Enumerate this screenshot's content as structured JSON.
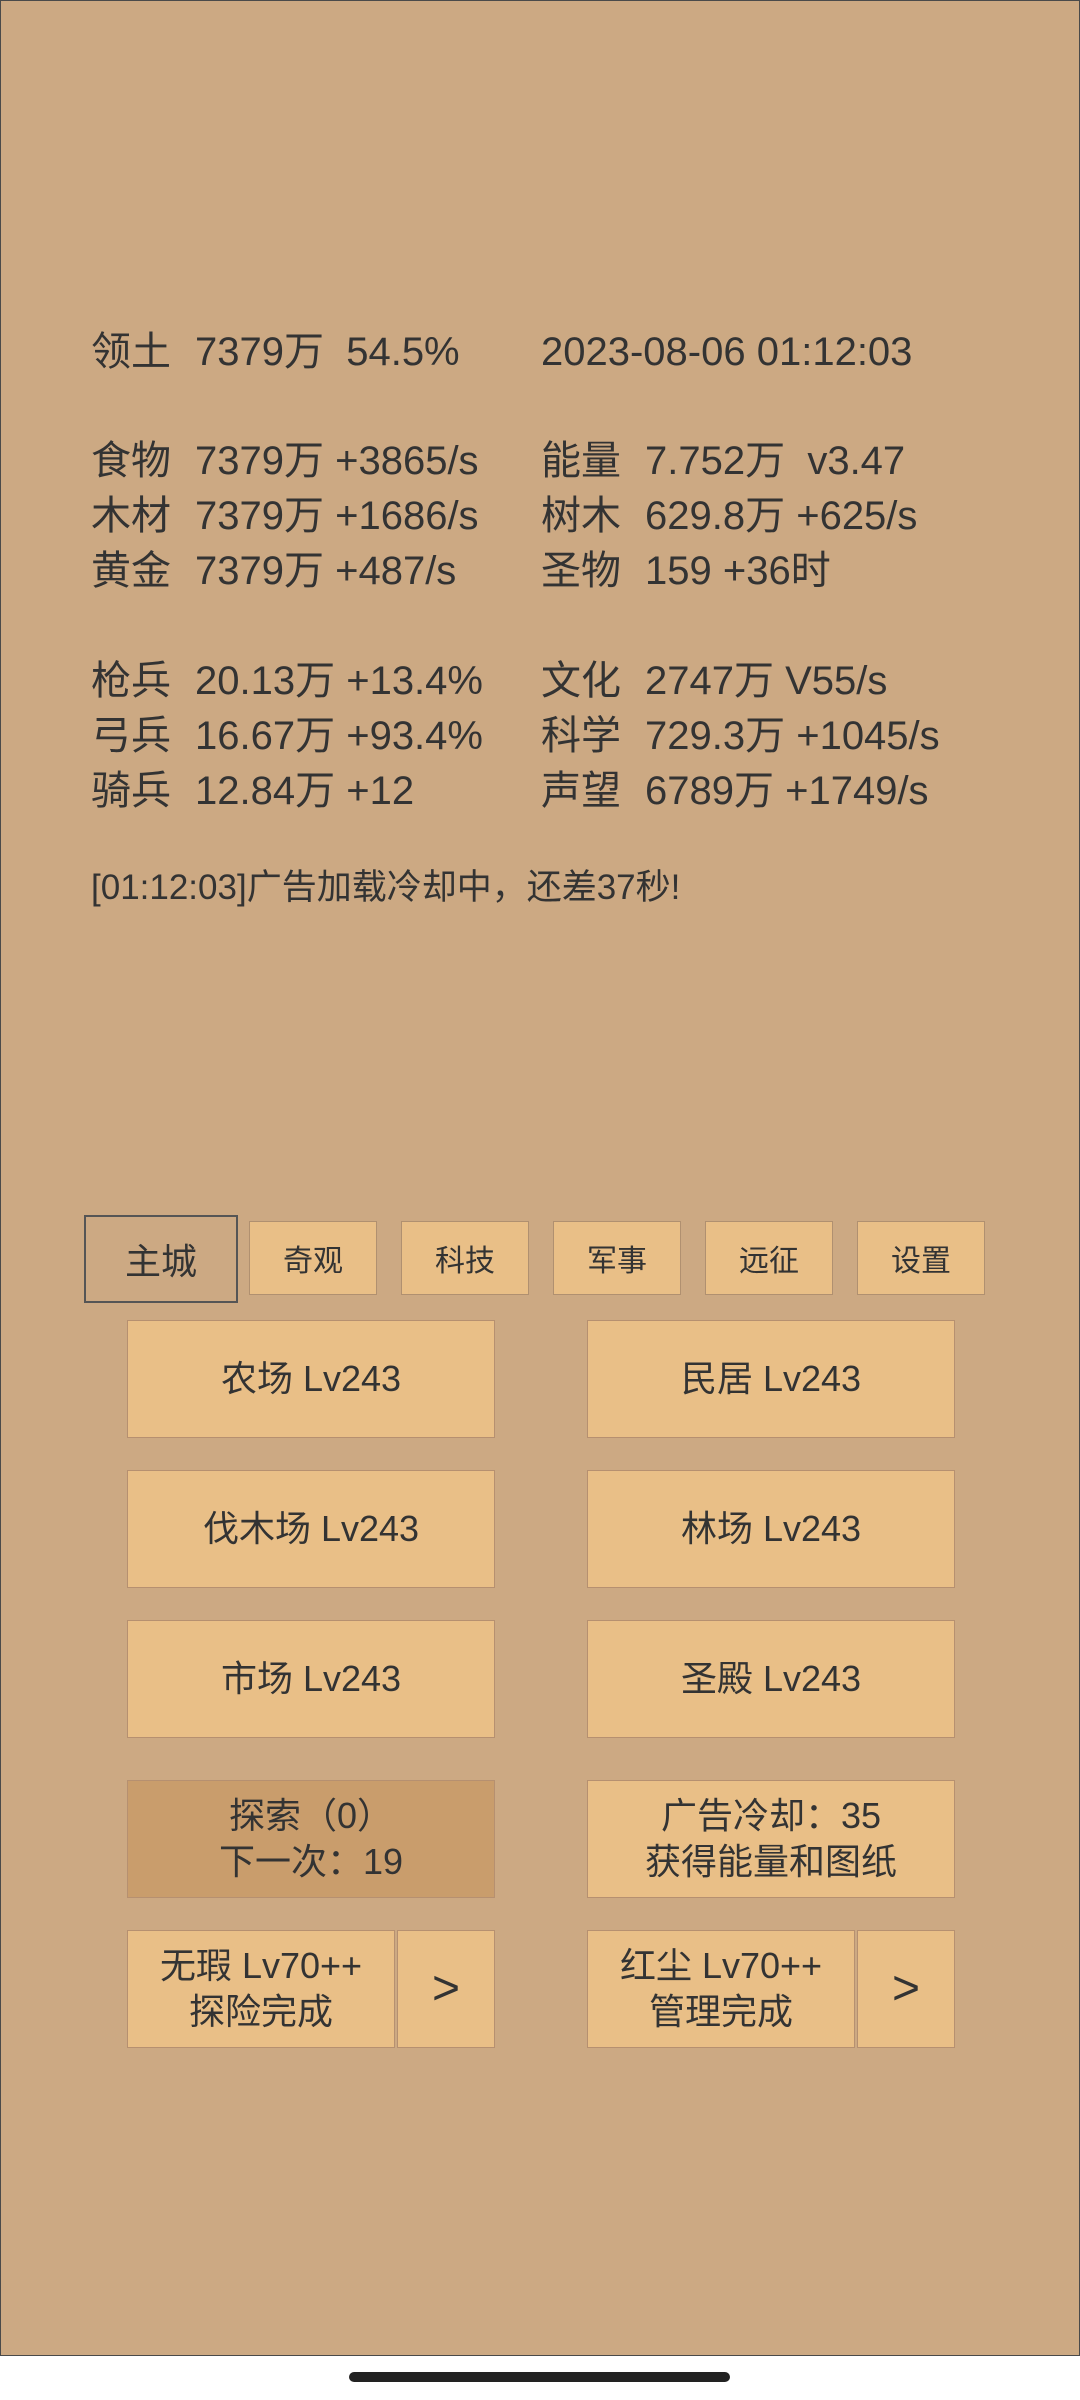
{
  "stats": {
    "territory": {
      "label": "领土",
      "value": "7379万  54.5%"
    },
    "datetime": "2023-08-06 01:12:03",
    "food": {
      "label": "食物",
      "value": "7379万 +3865/s"
    },
    "wood": {
      "label": "木材",
      "value": "7379万 +1686/s"
    },
    "gold": {
      "label": "黄金",
      "value": "7379万 +487/s"
    },
    "energy": {
      "label": "能量",
      "value": "7.752万  v3.47"
    },
    "trees": {
      "label": "树木",
      "value": "629.8万 +625/s"
    },
    "relics": {
      "label": "圣物",
      "value": "159 +36时"
    },
    "spearmen": {
      "label": "枪兵",
      "value": "20.13万 +13.4%"
    },
    "archers": {
      "label": "弓兵",
      "value": "16.67万 +93.4%"
    },
    "cavalry": {
      "label": "骑兵",
      "value": "12.84万 +12"
    },
    "culture": {
      "label": "文化",
      "value": "2747万 V55/s"
    },
    "science": {
      "label": "科学",
      "value": "729.3万 +1045/s"
    },
    "prestige": {
      "label": "声望",
      "value": "6789万 +1749/s"
    }
  },
  "log": "[01:12:03]广告加载冷却中，还差37秒!",
  "tabs": [
    "主城",
    "奇观",
    "科技",
    "军事",
    "远征",
    "设置"
  ],
  "buildings": [
    "农场 Lv243",
    "民居 Lv243",
    "伐木场 Lv243",
    "林场 Lv243",
    "市场 Lv243",
    "圣殿 Lv243"
  ],
  "explore": {
    "line1": "探索（0）",
    "line2": "下一次：19"
  },
  "ad": {
    "line1": "广告冷却：35",
    "line2": "获得能量和图纸"
  },
  "hero_left": {
    "line1": "无瑕 Lv70++",
    "line2": "探险完成",
    "arrow": ">"
  },
  "hero_right": {
    "line1": "红尘 Lv70++",
    "line2": "管理完成",
    "arrow": ">"
  },
  "colors": {
    "background": "#cca983",
    "button": "#e9bf87",
    "button_dark": "#c99d6c"
  }
}
